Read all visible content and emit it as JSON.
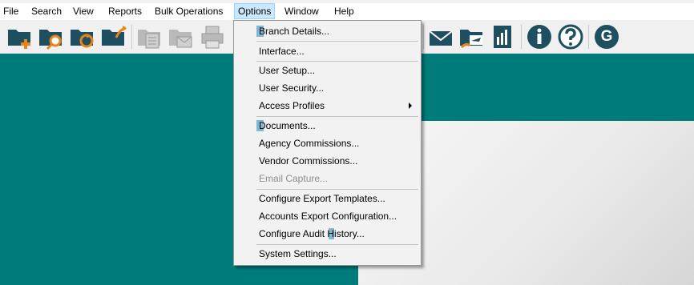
{
  "menubar": [
    "File",
    "Search",
    "View",
    "Reports",
    "Bulk Operations",
    "Options",
    "Window",
    "Help"
  ],
  "options_menu": {
    "items": [
      {
        "label": "Branch Details...",
        "enabled": true
      },
      {
        "label": "Interface...",
        "enabled": true
      },
      {
        "label": "User Setup...",
        "enabled": true
      },
      {
        "label": "User Security...",
        "enabled": true
      },
      {
        "label": "Access Profiles",
        "enabled": true,
        "submenu": true
      },
      {
        "label": "Documents...",
        "enabled": true
      },
      {
        "label": "Agency Commissions...",
        "enabled": true
      },
      {
        "label": "Vendor Commissions...",
        "enabled": true
      },
      {
        "label": "Email Capture...",
        "enabled": false
      },
      {
        "label": "Configure Export Templates...",
        "enabled": true
      },
      {
        "label": "Accounts Export Configuration...",
        "enabled": true
      },
      {
        "label": "Configure Audit History...",
        "enabled": true
      },
      {
        "label": "System Settings...",
        "enabled": true
      }
    ]
  },
  "toolbar": {
    "icons": [
      "new-folder-icon",
      "search-folder-icon",
      "folder-refresh-icon",
      "folder-import-icon",
      "document-list-icon",
      "mail-folder-icon",
      "printer-icon",
      "envelope-icon",
      "travel-folder-icon",
      "report-chart-icon",
      "info-icon",
      "help-icon",
      "g-icon"
    ],
    "g_letter": "G"
  },
  "colors": {
    "workspace": "#007b7b",
    "icon_dark": "#1d4f60",
    "accent_orange": "#e8841c",
    "menu_highlight": "#7fb8d4"
  }
}
